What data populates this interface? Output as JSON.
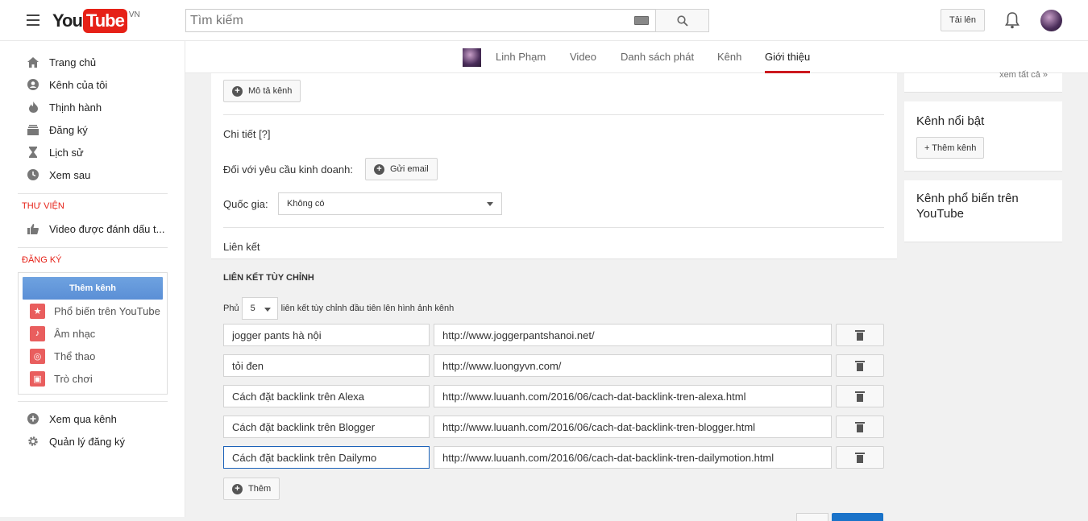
{
  "masthead": {
    "logo_you": "You",
    "logo_tube": "Tube",
    "logo_country": "VN",
    "search_placeholder": "Tìm kiếm",
    "upload_label": "Tải lên"
  },
  "sidebar": {
    "main_items": [
      {
        "label": "Trang chủ",
        "icon": "home-icon"
      },
      {
        "label": "Kênh của tôi",
        "icon": "account-icon"
      },
      {
        "label": "Thịnh hành",
        "icon": "flame-icon"
      },
      {
        "label": "Đăng ký",
        "icon": "subscriptions-icon"
      },
      {
        "label": "Lịch sử",
        "icon": "hourglass-icon"
      },
      {
        "label": "Xem sau",
        "icon": "clock-icon"
      }
    ],
    "library_title": "THƯ VIỆN",
    "library_items": [
      {
        "label": "Video được đánh dấu t...",
        "icon": "thumbs-up-icon"
      }
    ],
    "subscriptions_title": "ĐĂNG KÝ",
    "add_channel_label": "Thêm kênh",
    "sub_items": [
      {
        "label": "Phổ biến trên YouTube",
        "icon": "star-icon"
      },
      {
        "label": "Âm nhạc",
        "icon": "music-icon"
      },
      {
        "label": "Thể thao",
        "icon": "ball-icon"
      },
      {
        "label": "Trò chơi",
        "icon": "gamepad-icon"
      }
    ],
    "bottom_items": [
      {
        "label": "Xem qua kênh",
        "icon": "plus-circle-icon"
      },
      {
        "label": "Quản lý đăng ký",
        "icon": "gear-icon"
      }
    ]
  },
  "channel_tabs": {
    "items": [
      "Linh Phạm",
      "Video",
      "Danh sách phát",
      "Kênh",
      "Giới thiệu"
    ],
    "active": "Giới thiệu"
  },
  "about": {
    "channel_description_button": "Mô tả kênh",
    "details_heading": "Chi tiết [?]",
    "business_label": "Đối với yêu cầu kinh doanh:",
    "send_email_button": "Gửi email",
    "country_label": "Quốc gia:",
    "country_value": "Không có",
    "links_heading": "Liên kết",
    "custom_links_title": "LIÊN KẾT TÙY CHỈNH",
    "overlay_prefix": "Phủ",
    "overlay_count": "5",
    "overlay_suffix": "liên kết tùy chỉnh đầu tiên lên hình ảnh kênh",
    "links": [
      {
        "title": "jogger pants hà nội",
        "url": "http://www.joggerpantshanoi.net/"
      },
      {
        "title": "tỏi đen",
        "url": "http://www.luongyvn.com/"
      },
      {
        "title": "Cách đặt backlink trên Alexa",
        "url": "http://www.luuanh.com/2016/06/cach-dat-backlink-tren-alexa.html"
      },
      {
        "title": "Cách đặt backlink trên Blogger",
        "url": "http://www.luuanh.com/2016/06/cach-dat-backlink-tren-blogger.html"
      },
      {
        "title": "Cách đặt backlink trên Dailymo",
        "url": "http://www.luuanh.com/2016/06/cach-dat-backlink-tren-dailymotion.html"
      }
    ],
    "add_button": "Thêm"
  },
  "right_column": {
    "see_all": "xem tất cả",
    "featured_title": "Kênh nổi bật",
    "add_channel_button": "+ Thêm kênh",
    "popular_title": "Kênh phổ biến trên YouTube"
  },
  "colors": {
    "brand_red": "#e62117",
    "active_tab_underline": "#cc181e",
    "primary_blue": "#5b8fd6"
  }
}
